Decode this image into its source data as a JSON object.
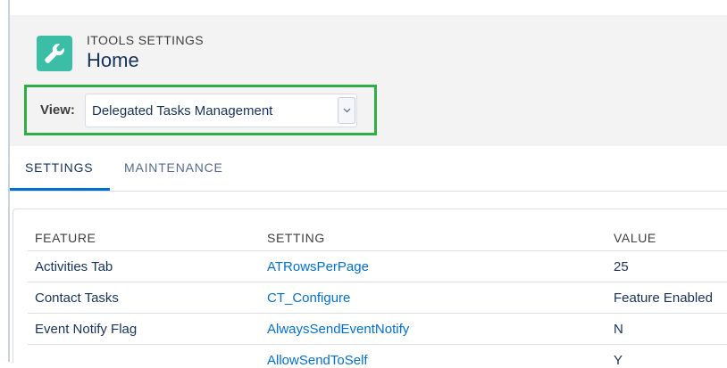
{
  "header": {
    "app_label": "ITOOLS SETTINGS",
    "title": "Home",
    "icon": "wrench-icon",
    "view_label": "View:",
    "view_selected": "Delegated Tasks Management"
  },
  "tabs": [
    {
      "label": "SETTINGS",
      "active": true
    },
    {
      "label": "MAINTENANCE",
      "active": false
    }
  ],
  "table": {
    "headers": [
      "FEATURE",
      "SETTING",
      "VALUE"
    ],
    "rows": [
      {
        "feature": "Activities Tab",
        "setting": "ATRowsPerPage",
        "value": "25"
      },
      {
        "feature": "Contact Tasks",
        "setting": "CT_Configure",
        "value": "Feature Enabled"
      },
      {
        "feature": "Event Notify Flag",
        "setting": "AlwaysSendEventNotify",
        "value": "N"
      },
      {
        "feature": "",
        "setting": "AllowSendToSelf",
        "value": "Y"
      }
    ]
  },
  "colors": {
    "icon_bg": "#3bbda6",
    "highlight": "#2fae45",
    "link": "#0070d2",
    "tab_active": "#0070d2"
  }
}
